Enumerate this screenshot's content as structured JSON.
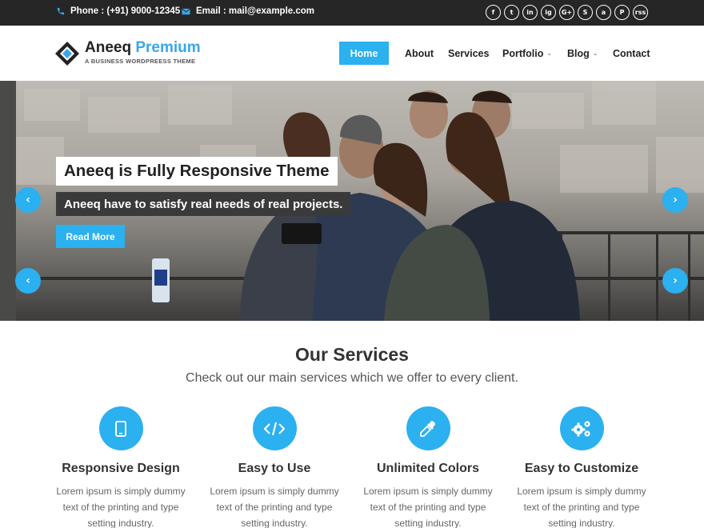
{
  "topbar": {
    "phone": "Phone : (+91) 9000-12345",
    "email": "Email : mail@example.com",
    "social_icons": [
      "facebook-icon",
      "twitter-icon",
      "linkedin-icon",
      "instagram-icon",
      "google-plus-icon",
      "skype-icon",
      "android-icon",
      "pinterest-icon",
      "rss-icon"
    ],
    "social_glyphs": [
      "f",
      "t",
      "in",
      "ig",
      "G+",
      "S",
      "a",
      "P",
      "rss"
    ]
  },
  "header": {
    "logo_name": "Aneeq",
    "logo_name_accent": "Premium",
    "logo_tagline": "A BUSINESS WORDPREESS THEME",
    "nav": [
      "Home",
      "About",
      "Services",
      "Portfolio",
      "Blog",
      "Contact"
    ],
    "active_nav": "Home"
  },
  "hero": {
    "title": "Aneeq is Fully Responsive Theme",
    "subtitle": "Aneeq have to satisfy real needs of real projects.",
    "button": "Read More",
    "prev_icon": "chevron-left-icon",
    "next_icon": "chevron-right-icon"
  },
  "services": {
    "title": "Our Services",
    "subtitle": "Check out our main services which we offer to every client.",
    "items": [
      {
        "icon": "mobile-icon",
        "name": "Responsive Design",
        "desc": "Lorem ipsum is simply dummy text of the printing and type setting industry."
      },
      {
        "icon": "code-icon",
        "name": "Easy to Use",
        "desc": "Lorem ipsum is simply dummy text of the printing and type setting industry."
      },
      {
        "icon": "eyedropper-icon",
        "name": "Unlimited Colors",
        "desc": "Lorem ipsum is simply dummy text of the printing and type setting industry."
      },
      {
        "icon": "gears-icon",
        "name": "Easy to Customize",
        "desc": "Lorem ipsum is simply dummy text of the printing and type setting industry."
      }
    ]
  },
  "colors": {
    "accent": "#2bb0f0",
    "topbar_bg": "#262626",
    "logo_accent": "#3aa6e8"
  }
}
